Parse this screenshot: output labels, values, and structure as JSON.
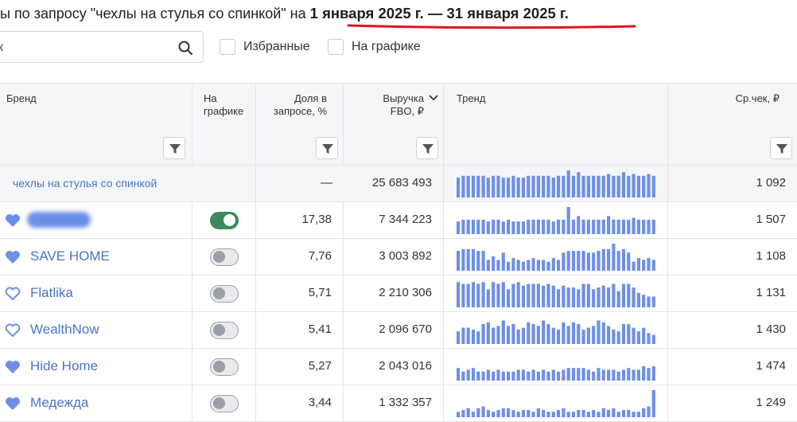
{
  "header": {
    "prefix": "ы по запросу  \"чехлы на стулья со спинкой\"  на  ",
    "dates": "1 января 2025 г. — 31 января 2025 г."
  },
  "search": {
    "value": "к"
  },
  "filters": {
    "favorites_label": "Избранные",
    "on_chart_label": "На графике"
  },
  "columns": {
    "brand": "Бренд",
    "on_chart": "На\nграфике",
    "share": "Доля в\nзапросе, %",
    "revenue": "Выручка\nFBO, ₽",
    "trend": "Тренд",
    "avg_check": "Ср.чек, ₽"
  },
  "total_row": {
    "label": "чехлы на стулья со спинкой",
    "share": "—",
    "revenue": "25 683 493",
    "avg_check": "1 092",
    "trend": [
      22,
      24,
      24,
      24,
      24,
      24,
      22,
      24,
      24,
      22,
      22,
      24,
      22,
      22,
      24,
      24,
      24,
      24,
      24,
      22,
      24,
      24,
      30,
      24,
      28,
      24,
      24,
      24,
      24,
      24,
      26,
      24,
      24,
      28,
      24,
      26,
      24,
      24,
      26,
      24
    ]
  },
  "rows": [
    {
      "brand": "",
      "brand_hidden": true,
      "favorite": true,
      "on_chart": true,
      "share": "17,38",
      "revenue": "7 344 223",
      "avg_check": "1 507",
      "trend": [
        14,
        16,
        16,
        16,
        16,
        16,
        14,
        16,
        16,
        14,
        16,
        14,
        14,
        14,
        16,
        16,
        16,
        16,
        16,
        14,
        16,
        16,
        30,
        16,
        20,
        16,
        16,
        16,
        16,
        16,
        20,
        16,
        16,
        16,
        16,
        18,
        16,
        16,
        16,
        16
      ]
    },
    {
      "brand": "SAVE HOME",
      "favorite": true,
      "on_chart": false,
      "share": "7,76",
      "revenue": "3 003 892",
      "avg_check": "1 108",
      "trend": [
        22,
        24,
        24,
        24,
        22,
        22,
        12,
        16,
        12,
        20,
        10,
        14,
        12,
        10,
        12,
        14,
        12,
        12,
        10,
        14,
        12,
        20,
        22,
        22,
        22,
        22,
        20,
        20,
        22,
        24,
        24,
        30,
        22,
        24,
        20,
        10,
        14,
        12,
        14,
        12
      ]
    },
    {
      "brand": "Flatlika",
      "favorite": false,
      "on_chart": false,
      "share": "5,71",
      "revenue": "2 210 306",
      "avg_check": "1 131",
      "trend": [
        28,
        26,
        26,
        28,
        26,
        28,
        20,
        28,
        26,
        28,
        20,
        26,
        28,
        24,
        26,
        26,
        26,
        24,
        26,
        24,
        20,
        24,
        22,
        22,
        20,
        26,
        26,
        20,
        22,
        24,
        22,
        26,
        18,
        26,
        26,
        22,
        16,
        14,
        12,
        12
      ]
    },
    {
      "brand": "WealthNow",
      "favorite": false,
      "on_chart": false,
      "share": "5,41",
      "revenue": "2 096 670",
      "avg_check": "1 430",
      "trend": [
        14,
        18,
        18,
        16,
        14,
        22,
        24,
        18,
        20,
        26,
        20,
        22,
        16,
        18,
        24,
        22,
        20,
        26,
        22,
        18,
        16,
        24,
        20,
        24,
        22,
        16,
        18,
        20,
        26,
        24,
        20,
        16,
        14,
        22,
        22,
        18,
        14,
        18,
        12,
        10
      ]
    },
    {
      "brand": "Hide Home",
      "favorite": true,
      "on_chart": false,
      "share": "5,27",
      "revenue": "2 043 016",
      "avg_check": "1 474",
      "trend": [
        14,
        10,
        12,
        14,
        10,
        10,
        12,
        10,
        12,
        10,
        10,
        10,
        12,
        12,
        10,
        12,
        10,
        12,
        10,
        12,
        10,
        12,
        14,
        14,
        14,
        14,
        12,
        10,
        14,
        12,
        12,
        12,
        10,
        12,
        14,
        12,
        12,
        16,
        14,
        16
      ]
    },
    {
      "brand": "Медежда",
      "favorite": true,
      "on_chart": false,
      "share": "3,44",
      "revenue": "1 332 357",
      "avg_check": "1 249",
      "trend": [
        6,
        8,
        10,
        6,
        10,
        12,
        8,
        6,
        8,
        10,
        10,
        8,
        6,
        8,
        8,
        6,
        10,
        8,
        6,
        6,
        8,
        10,
        6,
        6,
        8,
        8,
        6,
        8,
        6,
        10,
        8,
        10,
        6,
        8,
        8,
        6,
        6,
        10,
        12,
        30
      ]
    }
  ],
  "colors": {
    "accent": "#4a73c9",
    "bar": "#6e8fe8",
    "toggle_on": "#3c8a5a",
    "underline": "#e0141e"
  }
}
